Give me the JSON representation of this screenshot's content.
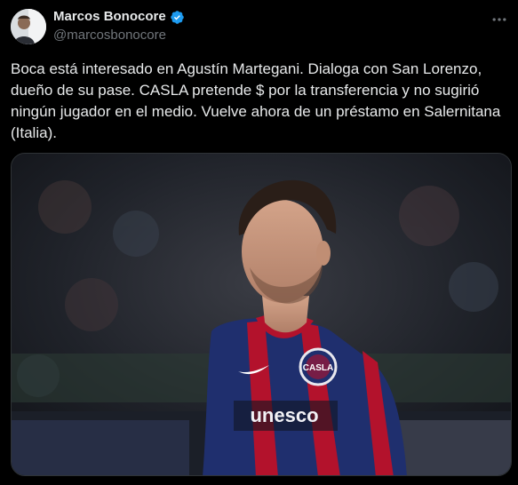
{
  "tweet": {
    "author": {
      "display_name": "Marcos Bonocore",
      "handle": "@marcosbonocore",
      "verified": true,
      "verified_color": "#1d9bf0"
    },
    "text": "Boca está interesado en Agustín Martegani. Dialoga con San Lorenzo, dueño de su pase. CASLA pretende $ por la transferencia y no sugirió ningún jugador en el medio. Vuelve ahora de un préstamo en Salernitana (Italia).",
    "media": {
      "type": "photo",
      "crest_text": "CASLA",
      "sponsor_text": "unesco"
    }
  },
  "icons": {
    "more": "more-horizontal-icon",
    "verified": "verified-badge-icon"
  },
  "colors": {
    "background": "#000000",
    "text": "#e7e9ea",
    "secondary": "#71767b",
    "jersey_blue": "#1f2f6e",
    "jersey_red": "#b3122c"
  }
}
